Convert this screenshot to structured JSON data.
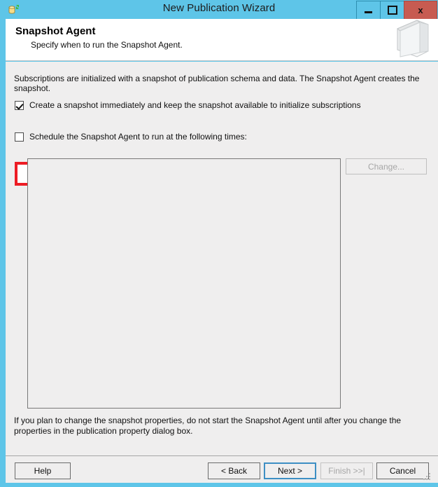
{
  "window": {
    "title": "New Publication Wizard",
    "icon": "replication-publication-icon",
    "controls": {
      "minimize": "minimize-icon",
      "maximize": "maximize-icon",
      "close": "x"
    },
    "accent_color": "#5ec5e8",
    "close_color": "#c75b51"
  },
  "header": {
    "title": "Snapshot Agent",
    "subtitle": "Specify when to run the Snapshot Agent.",
    "art": "book-icon"
  },
  "main": {
    "intro": "Subscriptions are initialized with a snapshot of publication schema and data. The Snapshot Agent creates the snapshot.",
    "checkbox_create": {
      "label": "Create a snapshot immediately and keep the snapshot available to initialize subscriptions",
      "checked": true,
      "highlighted": true,
      "highlight_color": "#ed1c24"
    },
    "checkbox_schedule": {
      "label": "Schedule the Snapshot Agent to run at the following times:",
      "checked": false
    },
    "change_button": {
      "label": "Change...",
      "enabled": false
    },
    "schedule_list": {
      "items": []
    },
    "note": "If you plan to change the snapshot properties, do not start the Snapshot Agent until after you change the properties in the publication property dialog box."
  },
  "footer": {
    "help": "Help",
    "back": "< Back",
    "next": "Next >",
    "finish": "Finish >>|",
    "cancel": "Cancel",
    "finish_enabled": false,
    "default_button": "next"
  }
}
